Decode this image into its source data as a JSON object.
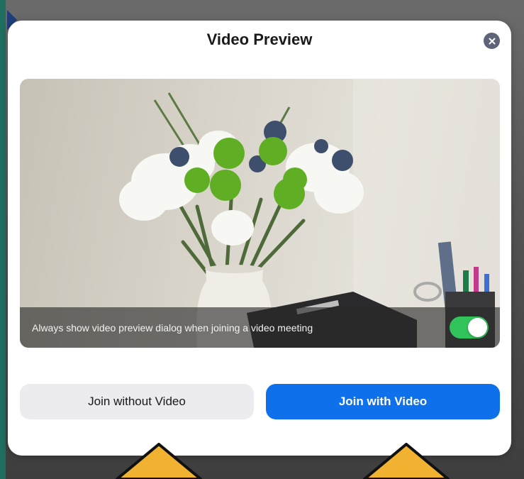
{
  "dialog": {
    "title": "Video Preview",
    "close_icon": "close-icon"
  },
  "preview": {
    "always_show_label": "Always show video preview dialog when joining a video meeting",
    "toggle_on": true
  },
  "buttons": {
    "join_without_video": "Join without Video",
    "join_with_video": "Join with Video"
  },
  "annotations": {
    "arrow_icon": "up-arrow-icon",
    "arrow_color": "#f0b230"
  },
  "colors": {
    "primary": "#0e71eb",
    "secondary_bg": "#ebebf0",
    "toggle_on": "#31c45a",
    "close_bg": "#5d6378"
  }
}
